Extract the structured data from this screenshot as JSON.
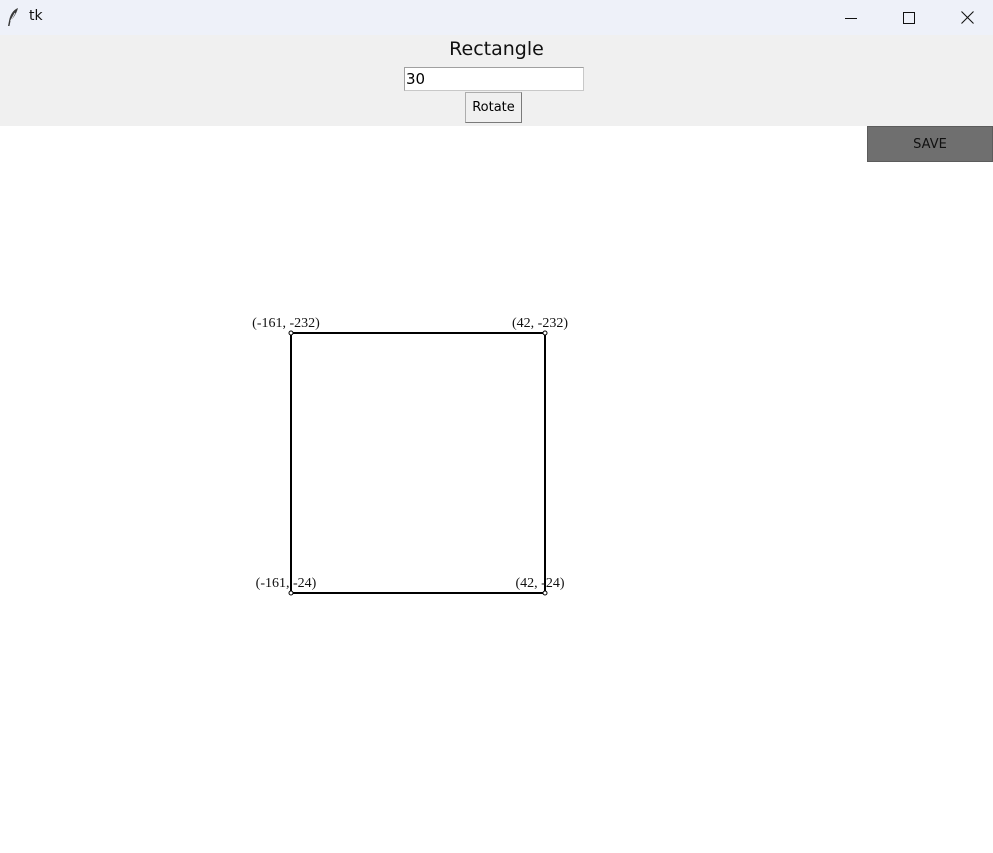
{
  "window": {
    "title": "tk",
    "icon": "feather-icon",
    "controls": [
      "minimize-icon",
      "maximize-icon",
      "close-icon"
    ]
  },
  "panel": {
    "title": "Rectangle",
    "angle_value": "30",
    "rotate_label": "Rotate"
  },
  "save": {
    "label": "SAVE",
    "color": "#6f6f6f"
  },
  "rectangle": {
    "vertices": [
      {
        "name": "top-left",
        "label": "(-161, -232)"
      },
      {
        "name": "top-right",
        "label": "(42, -232)"
      },
      {
        "name": "bottom-left",
        "label": "(-161, -24)"
      },
      {
        "name": "bottom-right",
        "label": "(42, -24)"
      }
    ]
  }
}
